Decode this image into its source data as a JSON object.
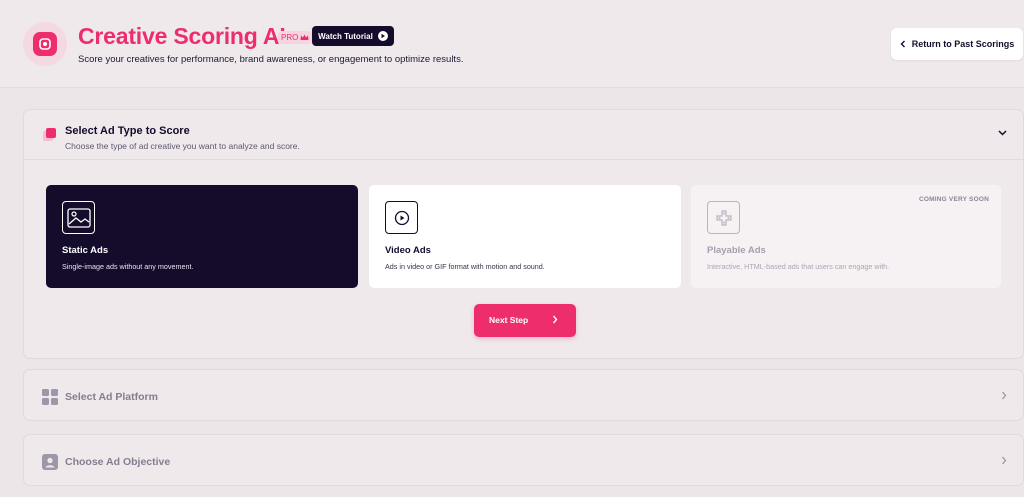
{
  "header": {
    "title": "Creative Scoring AI",
    "pro_badge": "PRO",
    "watch_tutorial": "Watch Tutorial",
    "subtitle": "Score your creatives for performance, brand awareness, or engagement to optimize results.",
    "return_button": "Return to Past Scorings"
  },
  "ad_type_section": {
    "title": "Select Ad Type to Score",
    "subtitle": "Choose the type of ad creative you want to analyze and score.",
    "cards": [
      {
        "title": "Static Ads",
        "description": "Single-image ads without any movement.",
        "icon": "image-icon",
        "selected": true
      },
      {
        "title": "Video Ads",
        "description": "Ads in video or GIF format with motion and sound.",
        "icon": "video-play-icon",
        "selected": false
      },
      {
        "title": "Playable Ads",
        "description": "Interactive, HTML-based ads that users can engage with.",
        "icon": "gamepad-icon",
        "selected": false,
        "badge": "COMING VERY SOON"
      }
    ],
    "next_button": "Next Step"
  },
  "platform_section": {
    "title": "Select Ad Platform"
  },
  "objective_section": {
    "title": "Choose Ad Objective"
  },
  "colors": {
    "accent": "#ee2d6c",
    "dark": "#150c2c",
    "background": "#ece6e9"
  }
}
